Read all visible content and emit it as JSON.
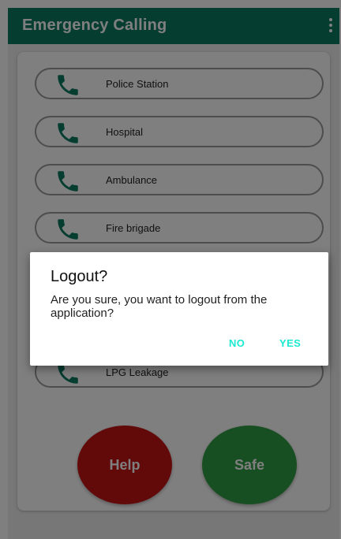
{
  "app_bar": {
    "title": "Emergency Calling",
    "menu_icon": "more-vert-icon"
  },
  "contacts": [
    {
      "label": "Police Station",
      "icon": "phone-icon"
    },
    {
      "label": "Hospital",
      "icon": "phone-icon"
    },
    {
      "label": "Ambulance",
      "icon": "phone-icon"
    },
    {
      "label": "Fire brigade",
      "icon": "phone-icon"
    },
    {
      "label": "LPG Leakage",
      "icon": "phone-icon"
    }
  ],
  "actions": {
    "help_label": "Help",
    "safe_label": "Safe"
  },
  "dialog": {
    "title": "Logout?",
    "message": "Are you sure, you want to logout from the application?",
    "negative_label": "NO",
    "positive_label": "YES"
  },
  "colors": {
    "primary": "#0a7a62",
    "phone_icon": "#0a7a62",
    "help_button": "#c41313",
    "safe_button": "#2f9e44",
    "dialog_action": "#1de9d0"
  }
}
